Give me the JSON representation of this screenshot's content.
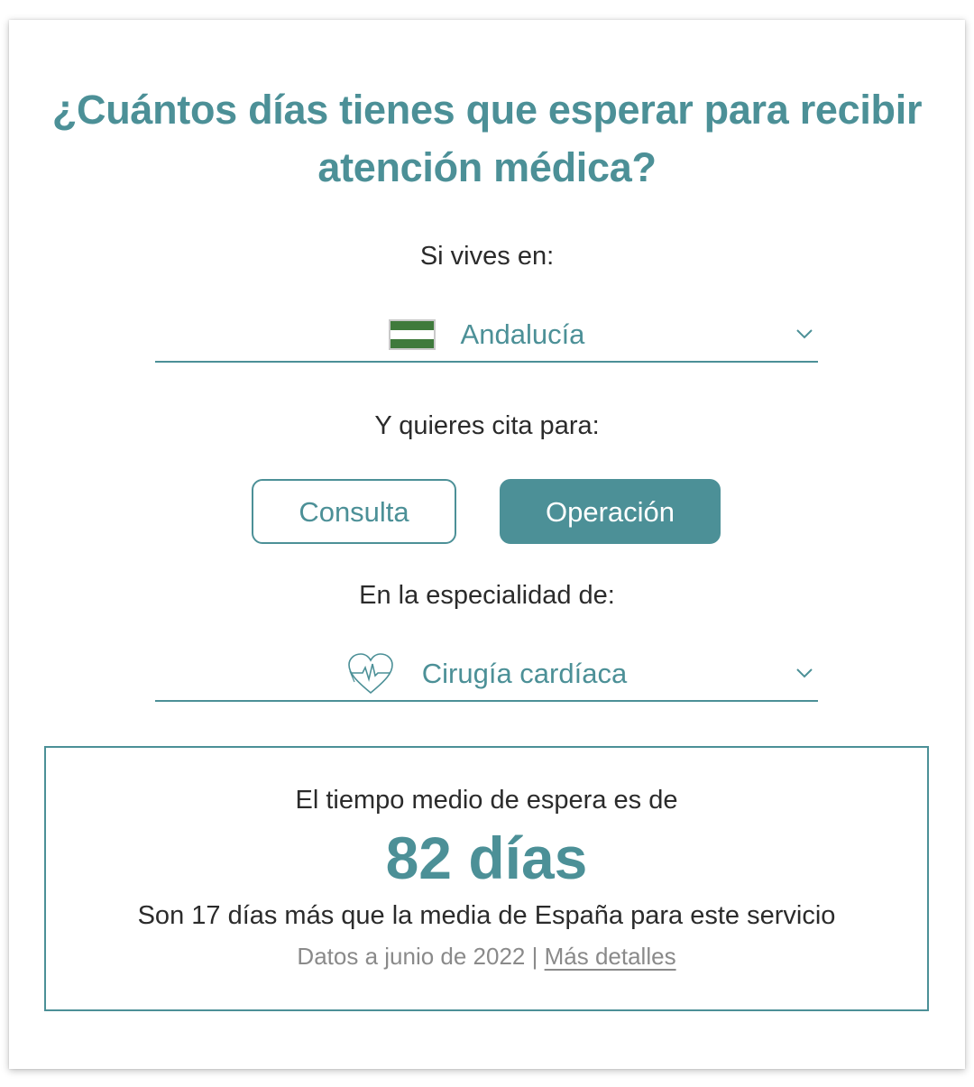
{
  "title": "¿Cuántos días tienes que esperar para recibir atención médica?",
  "region": {
    "label": "Si vives en:",
    "value": "Andalucía",
    "flag_icon": "andalucia-flag-icon",
    "colors": {
      "green": "#3f7a3c",
      "white": "#ffffff"
    }
  },
  "appointment": {
    "label": "Y quieres cita para:",
    "options": [
      "Consulta",
      "Operación"
    ],
    "selected": "Operación"
  },
  "specialty": {
    "label": "En la especialidad de:",
    "value": "Cirugía cardíaca",
    "icon": "heart-pulse-icon"
  },
  "result": {
    "intro": "El tiempo medio de espera es de",
    "days": "82 días",
    "comparison": "Son 17 días más que la media de España para este servicio",
    "source": "Datos a junio de 2022 |",
    "details_link": "Más detalles"
  },
  "colors": {
    "accent": "#4c9097",
    "text": "#2b2b2b",
    "muted": "#8a8a8a"
  }
}
